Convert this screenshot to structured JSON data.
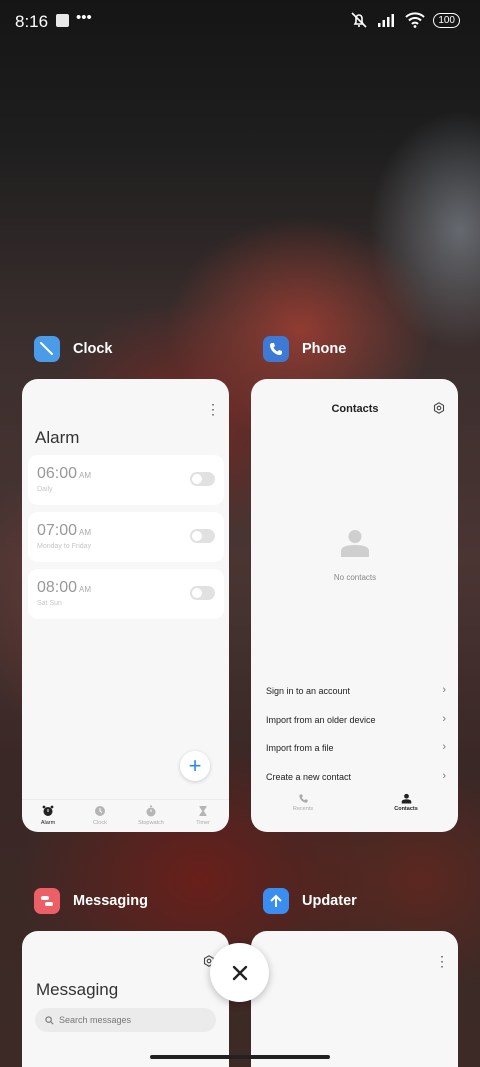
{
  "status_bar": {
    "time": "8:16",
    "battery": "100"
  },
  "apps": {
    "clock": {
      "name": "Clock",
      "title": "Alarm",
      "alarms": [
        {
          "time": "06:00",
          "ampm": "AM",
          "repeat": "Daily",
          "enabled": false
        },
        {
          "time": "07:00",
          "ampm": "AM",
          "repeat": "Monday to Friday",
          "enabled": false
        },
        {
          "time": "08:00",
          "ampm": "AM",
          "repeat": "Sat Sun",
          "enabled": false
        }
      ],
      "nav": [
        "Alarm",
        "Clock",
        "Stopwatch",
        "Timer"
      ],
      "active_nav": "Alarm"
    },
    "phone": {
      "name": "Phone",
      "title": "Contacts",
      "empty_text": "No contacts",
      "options": [
        "Sign in to an account",
        "Import from an older device",
        "Import from a file",
        "Create a new contact"
      ],
      "nav": [
        "Recents",
        "Contacts"
      ],
      "active_nav": "Contacts"
    },
    "messaging": {
      "name": "Messaging",
      "title": "Messaging",
      "search_placeholder": "Search messages"
    },
    "updater": {
      "name": "Updater"
    }
  },
  "colors": {
    "clock_icon": "#4a9be8",
    "phone_icon": "#3d7ad6",
    "messaging_icon": "#ec5f67",
    "updater_icon": "#3a8ef0",
    "accent": "#2c87f0"
  }
}
